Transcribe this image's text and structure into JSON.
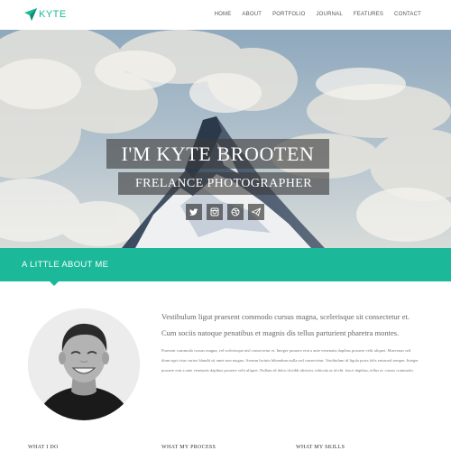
{
  "brand": {
    "name": "KYTE",
    "accent": "#1bb99a"
  },
  "nav": {
    "items": [
      "HOME",
      "ABOUT",
      "PORTFOLIO",
      "JOURNAL",
      "FEATURES",
      "CONTACT"
    ]
  },
  "hero": {
    "title": "I'M KYTE BROOTEN",
    "subtitle": "FRELANCE PHOTOGRAPHER",
    "socials": [
      "twitter-icon",
      "instagram-icon",
      "dribbble-icon",
      "paper-plane-icon"
    ]
  },
  "about": {
    "heading": "A LITTLE ABOUT ME",
    "lead1": "Vestibulum ligut praesent commodo cursus magna, scelerisque sit consectetur et.",
    "lead2": "Cum sociis natoque penatibus et magnis dis tellus parturient pharetra montes.",
    "body": "Praesent commodo cursus magna, vel scelerisque nisl consectetur et. Integer posuere erat a ante venenatis dapibus posuere velit aliquet. Maecenas sed diam eget risus varius blandit sit amet non magna. Aenean lacinia bibendum nulla sed consectetur. Vestibulum id ligula porta felis euismod semper. Integer posuere erat a ante venenatis dapibus posuere velit aliquet. Nullam id dolor id nibh ultricies vehicula ut id elit. fusce dapibus, tellus ac cursus commodo."
  },
  "sections": {
    "do": "WHAT I DO",
    "process": "WHAT MY PROCESS",
    "skills": "WHAT MY SKILLS"
  }
}
